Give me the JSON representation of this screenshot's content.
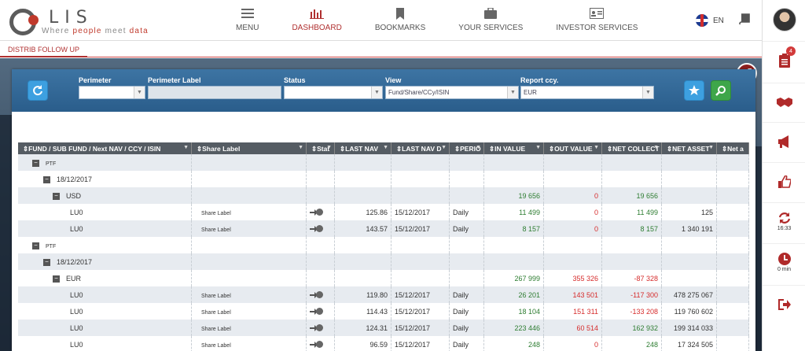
{
  "header": {
    "logo_text": "LIS",
    "tagline_pre": "Where ",
    "tagline_hl": "people",
    "tagline_mid": " meet ",
    "tagline_hl2": "data",
    "nav": [
      {
        "label": "MENU",
        "icon": "hamburger-icon"
      },
      {
        "label": "DASHBOARD",
        "icon": "bar-chart-icon",
        "active": true
      },
      {
        "label": "BOOKMARKS",
        "icon": "bookmark-icon"
      },
      {
        "label": "YOUR SERVICES",
        "icon": "briefcase-icon"
      },
      {
        "label": "INVESTOR SERVICES",
        "icon": "id-card-icon"
      }
    ],
    "lang": "EN"
  },
  "sidebar": {
    "notif_count": "4",
    "sync_time": "16:33",
    "timer": "0 min"
  },
  "breadcrumb": "DISTRIB FOLLOW UP",
  "filters": {
    "perimeter_label": "Perimeter",
    "perimeter_value": "",
    "perimeter_label2": "Perimeter Label",
    "status_label": "Status",
    "status_value": "",
    "view_label": "View",
    "view_value": "Fund/Share/CCy/ISIN",
    "ccy_label": "Report ccy.",
    "ccy_value": "EUR"
  },
  "grid": {
    "columns": [
      "FUND / SUB FUND / Next NAV / CCY / ISIN",
      "Share Label",
      "Stat",
      "LAST NAV",
      "LAST NAV D",
      "PERIO",
      "IN VALUE",
      "OUT VALUE",
      "NET COLLECT",
      "NET ASSET",
      "Net a"
    ],
    "rows": [
      {
        "level": 0,
        "tree": "PTF",
        "small": true
      },
      {
        "level": 1,
        "tree": "18/12/2017"
      },
      {
        "level": 2,
        "tree": "USD",
        "in": "19 656",
        "out": "0",
        "net": "19 656"
      },
      {
        "level": 3,
        "tree": "LU0",
        "share": "Share Label",
        "nav": "125.86",
        "navd": "15/12/2017",
        "per": "Daily",
        "in": "11 499",
        "out": "0",
        "net": "11 499",
        "asset": "125"
      },
      {
        "level": 3,
        "tree": "LU0",
        "share": "Share Label",
        "nav": "143.57",
        "navd": "15/12/2017",
        "per": "Daily",
        "in": "8 157",
        "out": "0",
        "net": "8 157",
        "asset": "1 340 191"
      },
      {
        "level": 0,
        "tree": "PTF",
        "small": true
      },
      {
        "level": 1,
        "tree": "18/12/2017"
      },
      {
        "level": 2,
        "tree": "EUR",
        "in": "267 999",
        "out": "355 326",
        "net": "-87 328"
      },
      {
        "level": 3,
        "tree": "LU0",
        "share": "Share Label",
        "nav": "119.80",
        "navd": "15/12/2017",
        "per": "Daily",
        "in": "26 201",
        "out": "143 501",
        "net": "-117 300",
        "asset": "478 275 067"
      },
      {
        "level": 3,
        "tree": "LU0",
        "share": "Share Label",
        "nav": "114.43",
        "navd": "15/12/2017",
        "per": "Daily",
        "in": "18 104",
        "out": "151 311",
        "net": "-133 208",
        "asset": "119 760 602"
      },
      {
        "level": 3,
        "tree": "LU0",
        "share": "Share Label",
        "nav": "124.31",
        "navd": "15/12/2017",
        "per": "Daily",
        "in": "223 446",
        "out": "60 514",
        "net": "162 932",
        "asset": "199 314 033"
      },
      {
        "level": 3,
        "tree": "LU0",
        "share": "Share Label",
        "nav": "96.59",
        "navd": "15/12/2017",
        "per": "Daily",
        "in": "248",
        "out": "0",
        "net": "248",
        "asset": "17 324 505"
      }
    ]
  },
  "colors": {
    "brand_red": "#b03030",
    "filter_blue": "#2a5d8b",
    "positive_green": "#2e7d32",
    "negative_red": "#d62c2c"
  }
}
